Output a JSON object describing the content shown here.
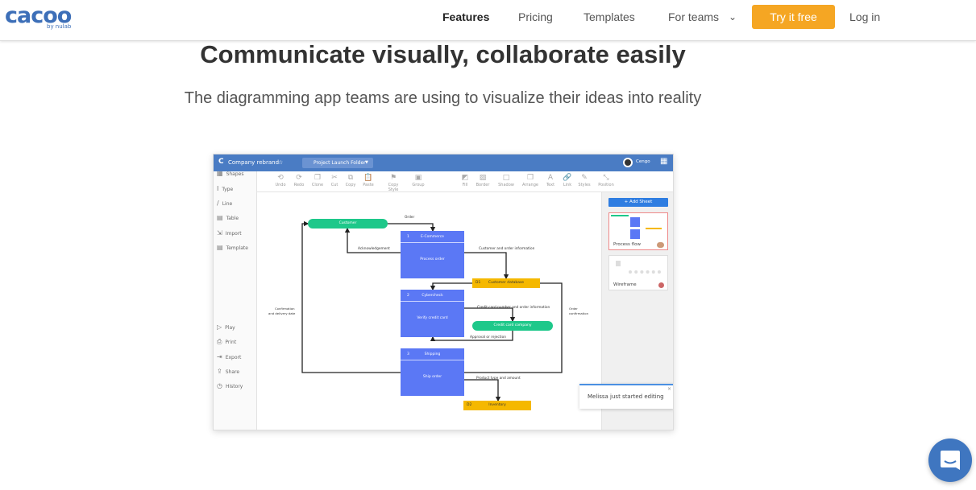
{
  "nav": {
    "logo": "cacoo",
    "logo_sub": "by nulab",
    "links": [
      "Features",
      "Pricing",
      "Templates",
      "For teams"
    ],
    "cta": "Try it free",
    "login": "Log in"
  },
  "hero": {
    "title": "Communicate visually, collaborate easily",
    "subtitle": "The diagramming app teams are using to visualize their ideas into reality"
  },
  "app": {
    "doc_title": "Company rebrand",
    "folder": "Project Launch Folder",
    "user": "Cengo",
    "toolbar": [
      "Undo",
      "Redo",
      "Clone",
      "Cut",
      "Copy",
      "Paste",
      "Copy Style",
      "Group",
      "Fill",
      "Border",
      "Shadow",
      "Arrange",
      "Text",
      "Link",
      "Styles",
      "Position"
    ],
    "sidebar_top": [
      "Shapes",
      "Type",
      "Line",
      "Table",
      "Import",
      "Template"
    ],
    "sidebar_bottom": [
      "Play",
      "Print",
      "Export",
      "Share",
      "History"
    ],
    "add_sheet": "+ Add Sheet",
    "sheets": [
      "Process flow",
      "Wireframe"
    ],
    "notification": "Melissa just started editing",
    "diagram": {
      "customer": "Customer",
      "p1": {
        "num": "1",
        "title": "E-Commerce",
        "body": "Process order"
      },
      "p2": {
        "num": "2",
        "title": "Cybercheck",
        "body": "Verify credit card"
      },
      "p3": {
        "num": "3",
        "title": "Shipping",
        "body": "Ship order"
      },
      "d1": {
        "id": "D1",
        "name": "Customer database"
      },
      "d2": {
        "id": "D2",
        "name": "Inventory"
      },
      "credit": "Credit card company",
      "labels": {
        "order": "Order",
        "ack": "Acknowledgement",
        "cust_info": "Customer and order information",
        "cc": "Credit card number and order information",
        "approval": "Approval or rejection",
        "conf1": "Confirmation",
        "conf2": "and delivery date",
        "oc1": "Order",
        "oc2": "confirmation",
        "product": "Product type and amount"
      }
    }
  },
  "colors": {
    "brand": "#3d6fb8",
    "cta": "#f5a623",
    "app_header": "#4a7cc4",
    "process": "#5b78f5",
    "external": "#1ec88a",
    "store": "#f5b800"
  }
}
